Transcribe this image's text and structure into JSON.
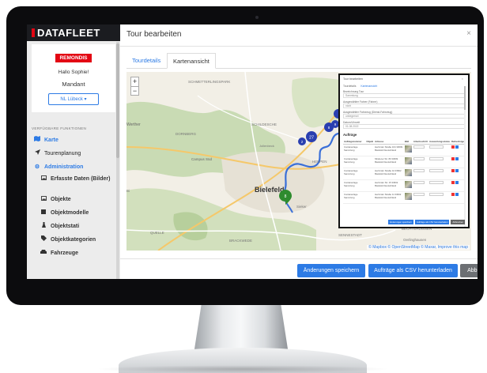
{
  "sidebar": {
    "brand": "DATAFLEET",
    "logo_text": "REMONDIS",
    "greeting": "Hallo Sophie!",
    "mandant": "Mandant",
    "branch_button": "NL Lübeck ▾",
    "section_label": "VERFÜGBARE FUNKTIONEN",
    "items": [
      {
        "label": "Karte",
        "icon": "map-icon"
      },
      {
        "label": "Tourenplanung",
        "icon": "location-arrow-icon"
      },
      {
        "label": "Administration",
        "icon": "cogs-icon"
      },
      {
        "label": "Erfasste Daten (Bilder)",
        "icon": "image-icon"
      },
      {
        "label": "Objekte",
        "icon": "image-icon"
      },
      {
        "label": "Objektmodelle",
        "icon": "cube-icon"
      },
      {
        "label": "Objektstati",
        "icon": "flask-icon"
      },
      {
        "label": "Objektkategorien",
        "icon": "tag-icon"
      },
      {
        "label": "Fahrzeuge",
        "icon": "car-icon"
      }
    ]
  },
  "modal": {
    "title": "Tour bearbeiten",
    "close": "×",
    "tabs": [
      "Tourdetails",
      "Kartenansicht"
    ],
    "buttons": {
      "save": "Änderungen speichern",
      "csv": "Aufträge als CSV herunterladen",
      "cancel": "Abbrechen"
    }
  },
  "map": {
    "zoom_in": "+",
    "zoom_out": "−",
    "city_label": "Bielefeld",
    "place_labels": [
      "SCHMETTERLINGSPARK",
      "Werther",
      "DORNBERG",
      "SCHILDESCHE",
      "Jollenbeck",
      "Campus Süd",
      "Sieker",
      "Bi",
      "BRACKWEDE",
      "SENNESTADT",
      "QUELLE",
      "HEEPEN",
      "STIEGHORST",
      "BECHTERDISSEN",
      "Oerlinghausen"
    ],
    "markers": [
      "12",
      "27",
      "2",
      "21",
      "8",
      "9"
    ],
    "attribution": "© Mapbox © OpenStreetMap © Maxar, Improve this map"
  },
  "tour_panel": {
    "title": "Tour bearbeiten",
    "tabs": [
      "Tourdetails",
      "Kartenansicht"
    ],
    "fields": [
      {
        "label": "Bezeichnung Tour",
        "value": "Sammlung"
      },
      {
        "label": "Ausgewählter Fahrer (Fahrer)",
        "value": "nicht"
      },
      {
        "label": "Ausgewählter Fahrzeug (Dienst-Fahrzeug)",
        "value": "unbegrenzt"
      },
      {
        "label": "Datum/Uhrzeit",
        "value": "01.08.2022"
      }
    ],
    "orders_heading": "Aufträge",
    "columns": [
      "Auftragsnummer",
      "Objekt",
      "Adresse",
      "Bild",
      "Arbeitsschritt",
      "Auswertungsstatus",
      "Reihenfolge"
    ],
    "rows": [
      {
        "nr": "Containerlage Sammlung",
        "addr": "Herforder Straße 104 33609 Bielefeld Deutschland"
      },
      {
        "nr": "Containerlage Sammlung",
        "addr": "Mindener Str. 80 33609 Bielefeld Deutschland"
      },
      {
        "nr": "Containerlage Sammlung",
        "addr": "Herforder Straße 44 33602 Bielefeld Deutschland"
      },
      {
        "nr": "Containerlage Sammlung",
        "addr": "Herforder Str. 15 33602 Bielefeld Deutschland"
      },
      {
        "nr": "Containerlage Sammlung",
        "addr": "Herforder Straße 11 33602 Bielefeld Deutschland"
      }
    ],
    "actions": [
      "Änderungen speichern",
      "Aufträge als CSV herunterladen",
      "Abbrechen"
    ]
  },
  "colors": {
    "accent": "#2d7be5",
    "brand_red": "#e30613",
    "marker_blue": "#2a3fb0",
    "marker_green": "#2e8b2e"
  }
}
